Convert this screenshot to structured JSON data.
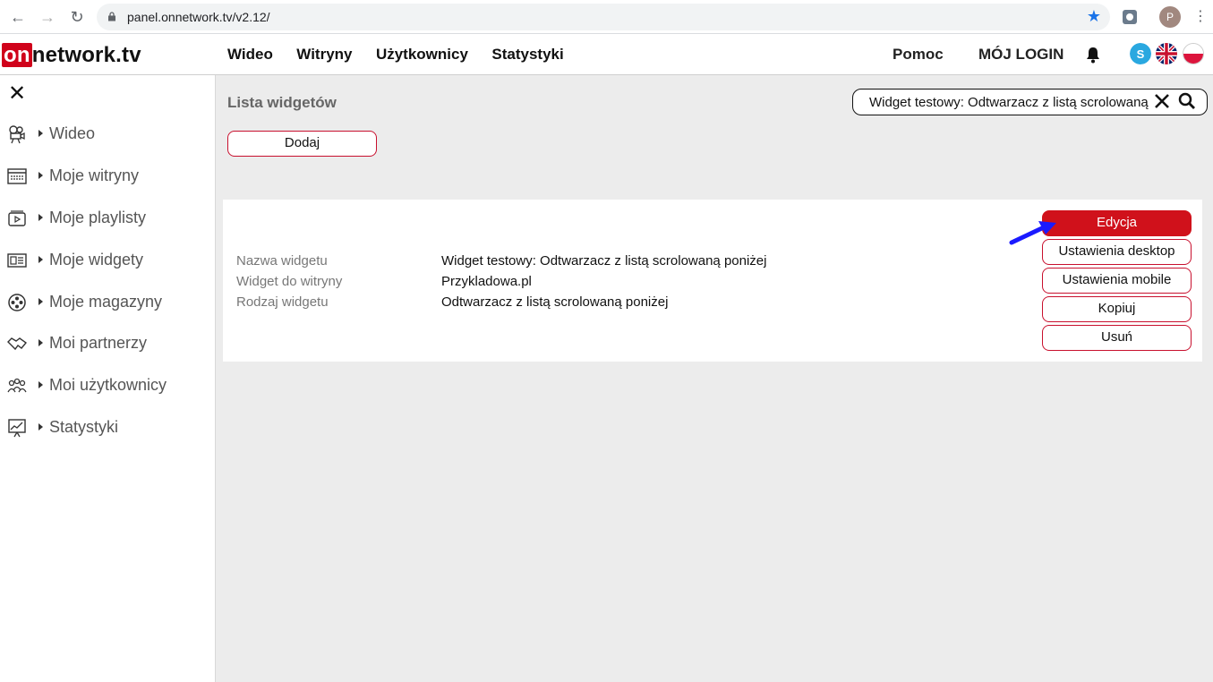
{
  "browser": {
    "url": "panel.onnetwork.tv/v2.12/",
    "avatar_letter": "P"
  },
  "header": {
    "logo_on": "on",
    "logo_rest": "network.tv",
    "nav": [
      "Wideo",
      "Witryny",
      "Użytkownicy",
      "Statystyki"
    ],
    "help": "Pomoc",
    "login": "MÓJ LOGIN"
  },
  "sidebar": {
    "items": [
      {
        "label": "Wideo",
        "icon": "camera-icon"
      },
      {
        "label": "Moje witryny",
        "icon": "website-icon"
      },
      {
        "label": "Moje playlisty",
        "icon": "playlist-icon"
      },
      {
        "label": "Moje widgety",
        "icon": "widget-icon"
      },
      {
        "label": "Moje magazyny",
        "icon": "film-reel-icon"
      },
      {
        "label": "Moi partnerzy",
        "icon": "handshake-icon"
      },
      {
        "label": "Moi użytkownicy",
        "icon": "users-icon"
      },
      {
        "label": "Statystyki",
        "icon": "statistics-icon"
      }
    ]
  },
  "main": {
    "title": "Lista widgetów",
    "search_value": "Widget testowy:  Odtwarzacz z listą scrolowaną poniżej",
    "add_label": "Dodaj",
    "widget": {
      "rows": [
        {
          "key": "Nazwa widgetu",
          "value": "Widget testowy: Odtwarzacz z listą scrolowaną poniżej"
        },
        {
          "key": "Widget do witryny",
          "value": "Przykladowa.pl"
        },
        {
          "key": "Rodzaj widgetu",
          "value": "Odtwarzacz z listą scrolowaną poniżej"
        }
      ],
      "actions": [
        "Edycja",
        "Ustawienia desktop",
        "Ustawienia mobile",
        "Kopiuj",
        "Usuń"
      ]
    }
  },
  "colors": {
    "brand_red": "#d0111b",
    "bg_main": "#ececec",
    "annotation_arrow": "#1a1aff"
  }
}
